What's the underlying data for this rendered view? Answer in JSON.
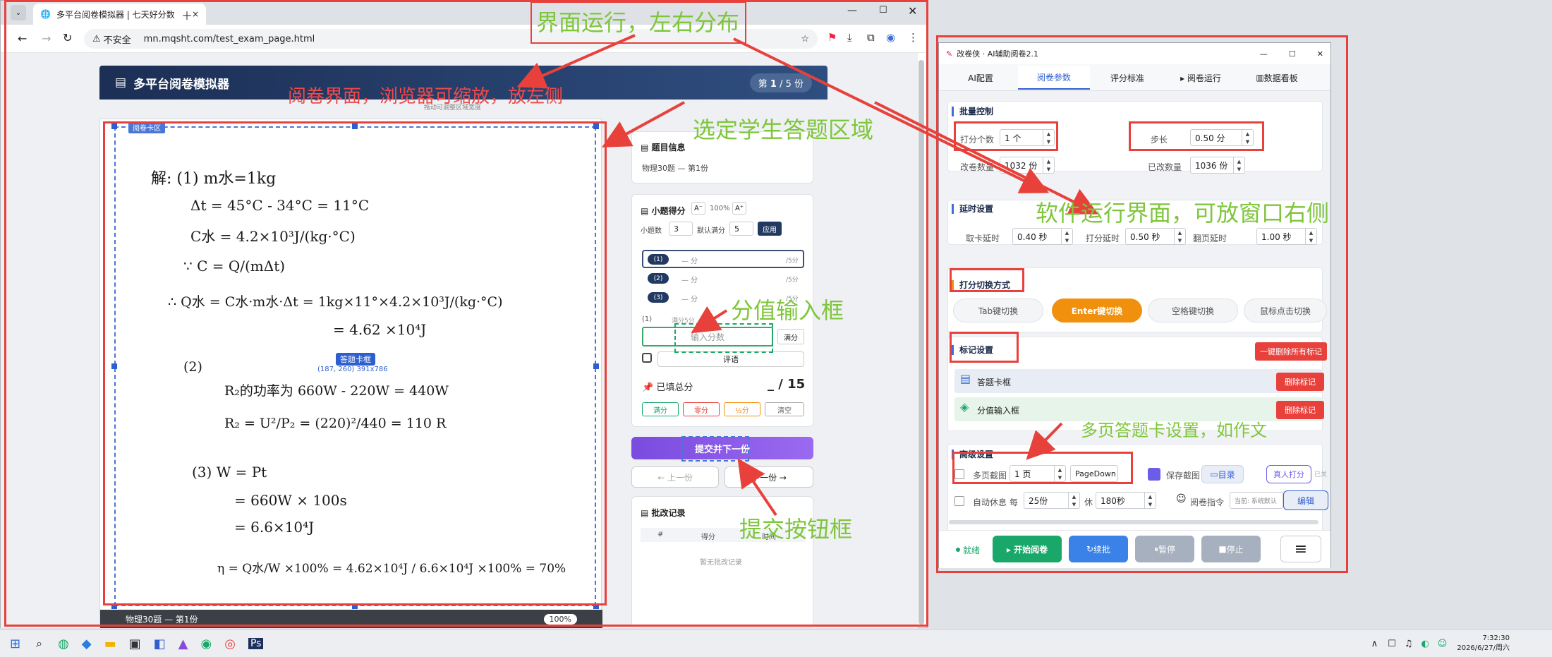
{
  "browser": {
    "tab_title": "多平台阅卷模拟器 | 七天好分数",
    "insecure_label": "不安全",
    "url": "mn.mqsht.com/test_exam_page.html"
  },
  "sim": {
    "header_title": "多平台阅卷模拟器",
    "page_badge_prefix": "第 ",
    "page_current": "1",
    "page_sep": " / ",
    "page_total": "5 份",
    "drag_hint": "拖动可调整区域宽度",
    "sel_label": "阅卷卡区",
    "answer_card_tag": "答题卡框",
    "answer_card_coords": "(187, 260) 391x786",
    "footer_text": "物理30题 — 第1份",
    "zoom": "100%",
    "info_title": "题目信息",
    "info_text": "物理30题 — 第1份",
    "score_title": "小题得分",
    "font_dec": "A⁻",
    "font_pct": "100%",
    "font_inc": "A⁺",
    "num_label": "小题数",
    "num_value": "3",
    "def_label": "默认满分",
    "def_value": "5",
    "apply": "应用",
    "items": [
      {
        "no": "(1)",
        "val": "— 分",
        "max": "/5分"
      },
      {
        "no": "(2)",
        "val": "— 分",
        "max": "/5分"
      },
      {
        "no": "(3)",
        "val": "— 分",
        "max": "/5分"
      }
    ],
    "sub_label": "(1)",
    "sub_full": "满分5分",
    "score_input_ph": "输入分数",
    "full_btn": "满分",
    "comment": "评语",
    "filled_label": "已填总分",
    "filled_value": "_ / 15",
    "quick": [
      "满分",
      "零分",
      "½分",
      "清空"
    ],
    "submit": "提交并下一份",
    "prev": "← 上一份",
    "next": "下一份 →",
    "log_title": "批改记录",
    "log_cols": [
      "#",
      "得分",
      "时间"
    ],
    "log_empty": "暂无批改记录"
  },
  "app": {
    "title": "改卷侠 · AI辅助阅卷2.1",
    "tabs": [
      "AI配置",
      "阅卷参数",
      "评分标准",
      "▸ 阅卷运行",
      "数据看板"
    ],
    "batch_title": "批量控制",
    "count_label": "打分个数",
    "count_value": "1 个",
    "step_label": "步长",
    "step_value": "0.50 分",
    "modify_label": "改卷数量",
    "modify_value": "1032 份",
    "done_label": "已改数量",
    "done_value": "1036 份",
    "delay_title": "延时设置",
    "d1_label": "取卡延时",
    "d1_value": "0.40 秒",
    "d2_label": "打分延时",
    "d2_value": "0.50 秒",
    "d3_label": "翻页延时",
    "d3_value": "1.00 秒",
    "switch_title": "打分切换方式",
    "switch_btns": [
      "Tab键切换",
      "Enter键切换",
      "空格键切换",
      "鼠标点击切换"
    ],
    "mark_title": "标记设置",
    "clear_all": "一键删除所有标记",
    "mark_items": [
      "答题卡框",
      "分值输入框"
    ],
    "delete_mark": "删除标记",
    "adv_title": "高级设置",
    "multi_label": "多页截图",
    "multi_value": "1 页",
    "pagedown": "PageDown",
    "save_shot": "保存截图",
    "dir_btn": "目录",
    "human": "真人打分",
    "human_suffix": "已关",
    "rest_label": "自动休息 每",
    "rest_value": "25份",
    "rest_mid": "休",
    "rest_secs": "180秒",
    "cmd_label": "阅卷指令",
    "cmd_value": "当前: 系统默认",
    "edit": "编辑",
    "status": "就绪",
    "start": "▸ 开始阅卷",
    "batch_btn": "续批",
    "pause": "暂停",
    "stop": "停止",
    "menu": "≡"
  },
  "annotations": {
    "a1": "界面运行，左右分布",
    "a2": "阅卷界面，浏览器可缩放，放左侧",
    "a3": "选定学生答题区域",
    "a4": "软件运行界面，可放窗口右侧",
    "a5": "分值输入框",
    "a6": "多页答题卡设置，如作文",
    "a7": "提交按钮框"
  },
  "taskbar": {
    "time": "7:32:30",
    "date": "2026/6/27/周六"
  },
  "handwriting": {
    "l1": "解: (1) m水=1kg",
    "l2": "Δt = 45°C - 34°C = 11°C",
    "l3": "C水 = 4.2×10³J/(kg·°C)",
    "l4": "∵ C = Q/(mΔt)",
    "l5": "∴ Q水 = C水·m水·Δt = 1kg×11°×4.2×10³J/(kg·°C)",
    "l6": "= 4.62 ×10⁴J",
    "l7": "(2)",
    "l8": "R₂的功率为 660W - 220W = 440W",
    "l9": "R₂ = U²/P₂ = (220)²/440 = 110 R",
    "l10": "(3) W = Pt",
    "l11": "= 660W × 100s",
    "l12": "= 6.6×10⁴J",
    "l13": "η = Q水/W ×100% = 4.62×10⁴J / 6.6×10⁴J ×100% = 70%"
  },
  "colors": {
    "accent": "#3b6fd8",
    "orange": "#f0900c",
    "red": "#e8413c",
    "green": "#1aa86a",
    "annotation": "#7ec63b"
  }
}
